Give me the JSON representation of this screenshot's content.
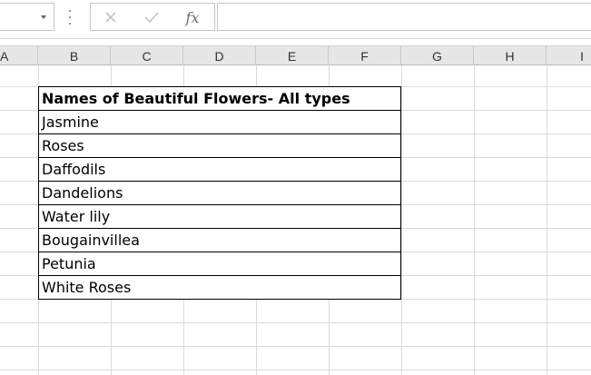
{
  "formula_bar": {
    "name_box_value": "",
    "fx_label": "fx",
    "formula_value": "",
    "cancel_icon": "x-icon",
    "enter_icon": "checkmark-icon"
  },
  "columns": [
    "A",
    "B",
    "C",
    "D",
    "E",
    "F",
    "G",
    "H",
    "I"
  ],
  "table": {
    "header": "Names of Beautiful Flowers- All types",
    "rows": [
      "Jasmine",
      "Roses",
      "Daffodils",
      "Dandelions",
      "Water lily",
      "Bougainvillea",
      "Petunia",
      "White Roses"
    ]
  },
  "colors": {
    "header_bg": "#e6e6e6",
    "gridline": "#dadada",
    "table_border": "#000000"
  }
}
